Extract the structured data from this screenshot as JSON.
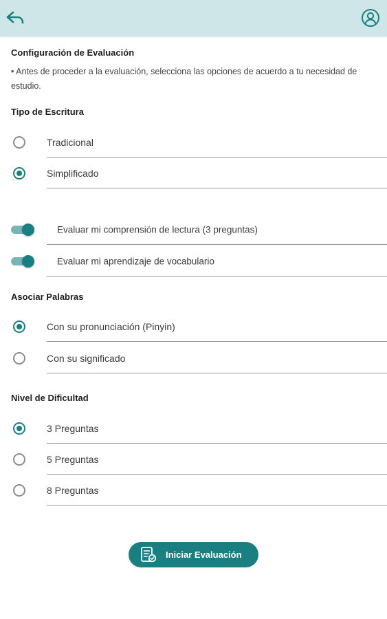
{
  "header": {
    "back_icon": "back-arrow-icon",
    "profile_icon": "user-profile-icon"
  },
  "config": {
    "title": "Configuración de Evaluación",
    "intro": "• Antes de proceder a la evaluación, selecciona las opciones de acuerdo a tu necesidad de estudio."
  },
  "writing": {
    "title": "Tipo de Escritura",
    "options": [
      {
        "label": "Tradicional",
        "selected": false
      },
      {
        "label": "Simplificado",
        "selected": true
      }
    ]
  },
  "toggles": [
    {
      "label": "Evaluar mi comprensión de lectura (3 preguntas)",
      "on": true
    },
    {
      "label": "Evaluar mi aprendizaje de vocabulario",
      "on": true
    }
  ],
  "associate": {
    "title": "Asociar Palabras",
    "options": [
      {
        "label": "Con su pronunciación (Pinyin)",
        "selected": true
      },
      {
        "label": "Con su significado",
        "selected": false
      }
    ]
  },
  "difficulty": {
    "title": "Nivel de Dificultad",
    "options": [
      {
        "label": "3 Preguntas",
        "selected": true
      },
      {
        "label": "5 Preguntas",
        "selected": false
      },
      {
        "label": "8 Preguntas",
        "selected": false
      }
    ]
  },
  "start_button": {
    "label": "Iniciar Evaluación",
    "icon": "evaluation-document-icon"
  },
  "colors": {
    "accent": "#1a7f80",
    "header_bg": "#cfe6e8",
    "toggle_track": "#76b4b6"
  }
}
